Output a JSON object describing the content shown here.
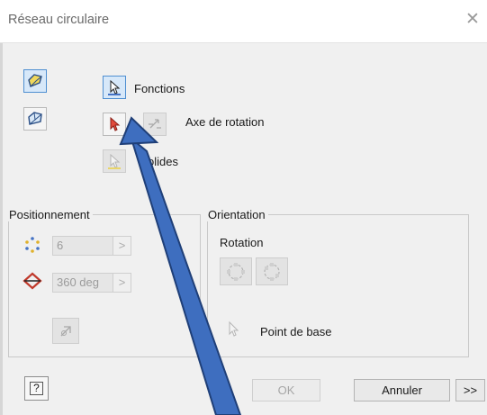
{
  "window": {
    "title": "Réseau circulaire"
  },
  "selectors": {
    "fonctions_label": "Fonctions",
    "axe_label": "Axe de rotation",
    "solides_label": "olides"
  },
  "positionnement": {
    "legend": "Positionnement",
    "count_value": "6",
    "angle_value": "360 deg",
    "arrow": ">"
  },
  "orientation": {
    "legend": "Orientation",
    "rotation_label": "Rotation",
    "base_point_label": "Point de base"
  },
  "footer": {
    "help_label": "?",
    "ok_label": "OK",
    "cancel_label": "Annuler",
    "more_label": ">>"
  },
  "colors": {
    "accent_blue": "#4472c4",
    "arrow_blue": "#3e6ebf",
    "selector_red": "#c0392b",
    "icon_yellow": "#e9d56a"
  },
  "icons": {
    "close": "close-icon",
    "annotation": "annotation-arrow"
  }
}
